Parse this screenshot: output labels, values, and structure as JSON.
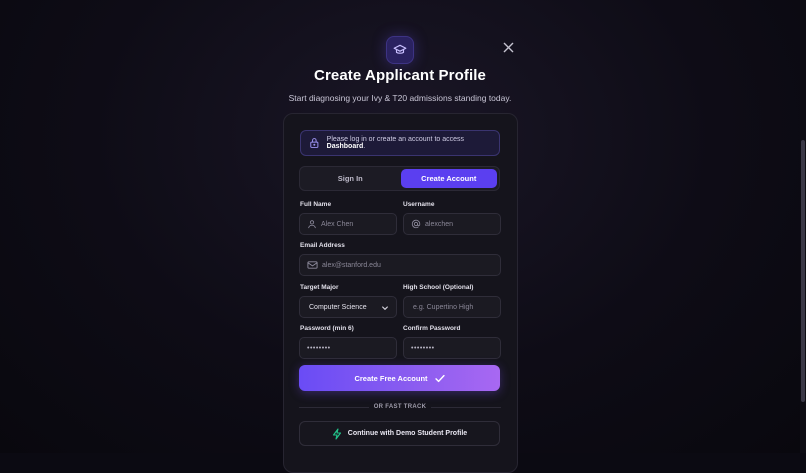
{
  "header": {
    "title": "Create Applicant Profile",
    "subtitle": "Start diagnosing your Ivy & T20 admissions standing today.",
    "logo_icon": "graduation-cap-icon",
    "close_icon": "close-icon"
  },
  "notice": {
    "icon": "lock-icon",
    "text_before": "Please log in or create an account to access ",
    "text_bold": "Dashboard",
    "text_after": "."
  },
  "tabs": [
    {
      "label": "Sign In",
      "active": false
    },
    {
      "label": "Create Account",
      "active": true
    }
  ],
  "form": {
    "full_name": {
      "label": "Full Name",
      "placeholder": "Alex Chen",
      "icon": "user-icon"
    },
    "username": {
      "label": "Username",
      "placeholder": "alexchen",
      "icon": "at-sign-icon"
    },
    "email": {
      "label": "Email Address",
      "placeholder": "alex@stanford.edu",
      "icon": "mail-icon"
    },
    "target_major": {
      "label": "Target Major",
      "value": "Computer Science",
      "icon": "chevron-down-icon"
    },
    "high_school": {
      "label": "High School (Optional)",
      "placeholder": "e.g. Cupertino High"
    },
    "password": {
      "label": "Password (min 6)",
      "value": "••••••••"
    },
    "confirm_password": {
      "label": "Confirm Password",
      "value": "••••••••"
    }
  },
  "primary_button": {
    "label": "Create Free Account",
    "icon": "check-icon"
  },
  "divider": {
    "text": "OR FAST TRACK"
  },
  "demo_button": {
    "label": "Continue with Demo Student Profile",
    "icon": "lightning-bolt-icon"
  },
  "colors": {
    "accent": "#5b3ff0",
    "gradient_start": "#6a4cf5",
    "gradient_end": "#a868f2",
    "bolt": "#22c38a",
    "background": "#0b0a12"
  }
}
